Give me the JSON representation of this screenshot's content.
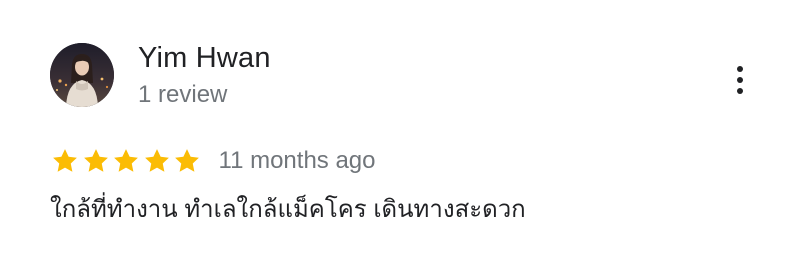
{
  "reviewer": {
    "name": "Yim Hwan",
    "meta": "1 review",
    "avatar_icon": "profile-photo"
  },
  "more_options": {
    "icon": "more-vertical-icon"
  },
  "rating": {
    "stars": 5,
    "max_stars": 5,
    "star_color": "#fbbc04",
    "time": "11 months ago"
  },
  "review": {
    "text": "ใกล้ที่ทำงาน ทำเลใกล้แม็คโคร เดินทางสะดวก"
  },
  "colors": {
    "primary_text": "#202124",
    "secondary_text": "#70757a",
    "background": "#ffffff"
  }
}
